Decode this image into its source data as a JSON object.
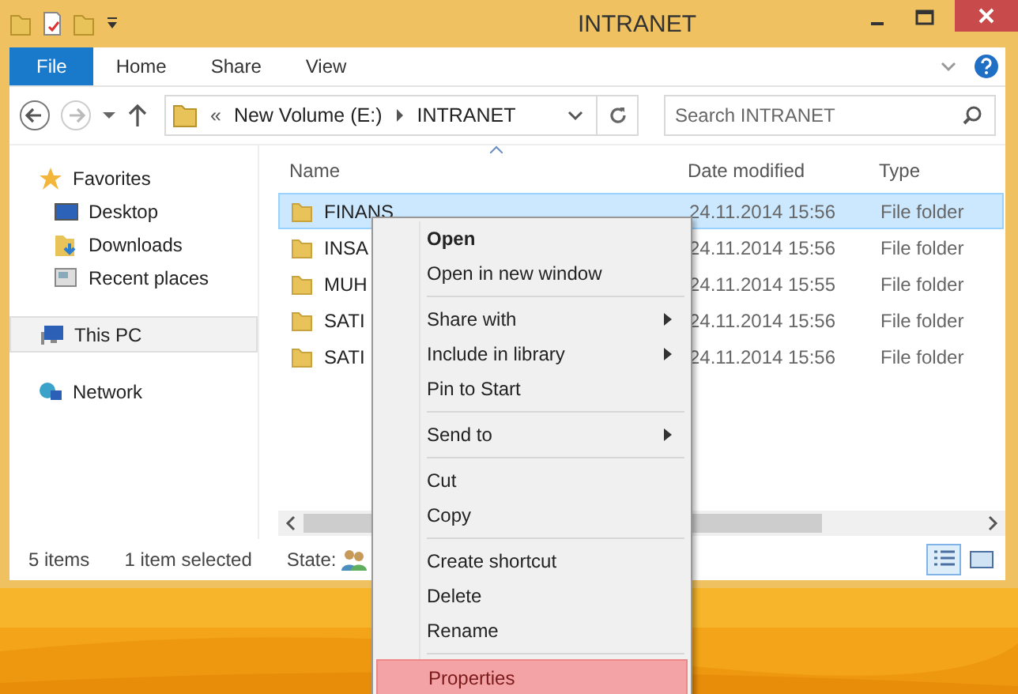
{
  "window": {
    "title": "INTRANET"
  },
  "ribbon_tabs": [
    {
      "label": "File",
      "selected": true
    },
    {
      "label": "Home",
      "selected": false
    },
    {
      "label": "Share",
      "selected": false
    },
    {
      "label": "View",
      "selected": false
    }
  ],
  "address": {
    "overflow": "«",
    "crumbs": [
      "New Volume (E:)",
      "INTRANET"
    ]
  },
  "search": {
    "placeholder": "Search INTRANET"
  },
  "sidebar": {
    "items": [
      {
        "label": "Favorites",
        "selected": false,
        "children": [
          {
            "label": "Desktop",
            "selected": false
          },
          {
            "label": "Downloads",
            "selected": false
          },
          {
            "label": "Recent places",
            "selected": false
          }
        ]
      },
      {
        "label": "This PC",
        "selected": true
      },
      {
        "label": "Network",
        "selected": false
      }
    ]
  },
  "table": {
    "columns": [
      "Name",
      "Date modified",
      "Type"
    ],
    "rows": [
      {
        "name": "FINANS",
        "date": "24.11.2014 15:56",
        "type": "File folder",
        "selected": true
      },
      {
        "name": "INSA",
        "date": "24.11.2014 15:56",
        "type": "File folder",
        "selected": false
      },
      {
        "name": "MUH",
        "date": "24.11.2014 15:55",
        "type": "File folder",
        "selected": false
      },
      {
        "name": "SATI",
        "date": "24.11.2014 15:56",
        "type": "File folder",
        "selected": false
      },
      {
        "name": "SATI",
        "date": "24.11.2014 15:56",
        "type": "File folder",
        "selected": false
      }
    ]
  },
  "status_bar": {
    "count": "5 items",
    "selection": "1 item selected",
    "state": "State:"
  },
  "context_menu": [
    {
      "kind": "item",
      "label": "Open",
      "bold": true,
      "submenu": false,
      "selected": false
    },
    {
      "kind": "item",
      "label": "Open in new window",
      "bold": false,
      "submenu": false,
      "selected": false
    },
    {
      "kind": "separator"
    },
    {
      "kind": "item",
      "label": "Share with",
      "bold": false,
      "submenu": true,
      "selected": false
    },
    {
      "kind": "item",
      "label": "Include in library",
      "bold": false,
      "submenu": true,
      "selected": false
    },
    {
      "kind": "item",
      "label": "Pin to Start",
      "bold": false,
      "submenu": false,
      "selected": false
    },
    {
      "kind": "separator"
    },
    {
      "kind": "item",
      "label": "Send to",
      "bold": false,
      "submenu": true,
      "selected": false
    },
    {
      "kind": "separator"
    },
    {
      "kind": "item",
      "label": "Cut",
      "bold": false,
      "submenu": false,
      "selected": false
    },
    {
      "kind": "item",
      "label": "Copy",
      "bold": false,
      "submenu": false,
      "selected": false
    },
    {
      "kind": "separator"
    },
    {
      "kind": "item",
      "label": "Create shortcut",
      "bold": false,
      "submenu": false,
      "selected": false
    },
    {
      "kind": "item",
      "label": "Delete",
      "bold": false,
      "submenu": false,
      "selected": false
    },
    {
      "kind": "item",
      "label": "Rename",
      "bold": false,
      "submenu": false,
      "selected": false
    },
    {
      "kind": "separator"
    },
    {
      "kind": "item",
      "label": "Properties",
      "bold": false,
      "submenu": false,
      "selected": true
    }
  ]
}
